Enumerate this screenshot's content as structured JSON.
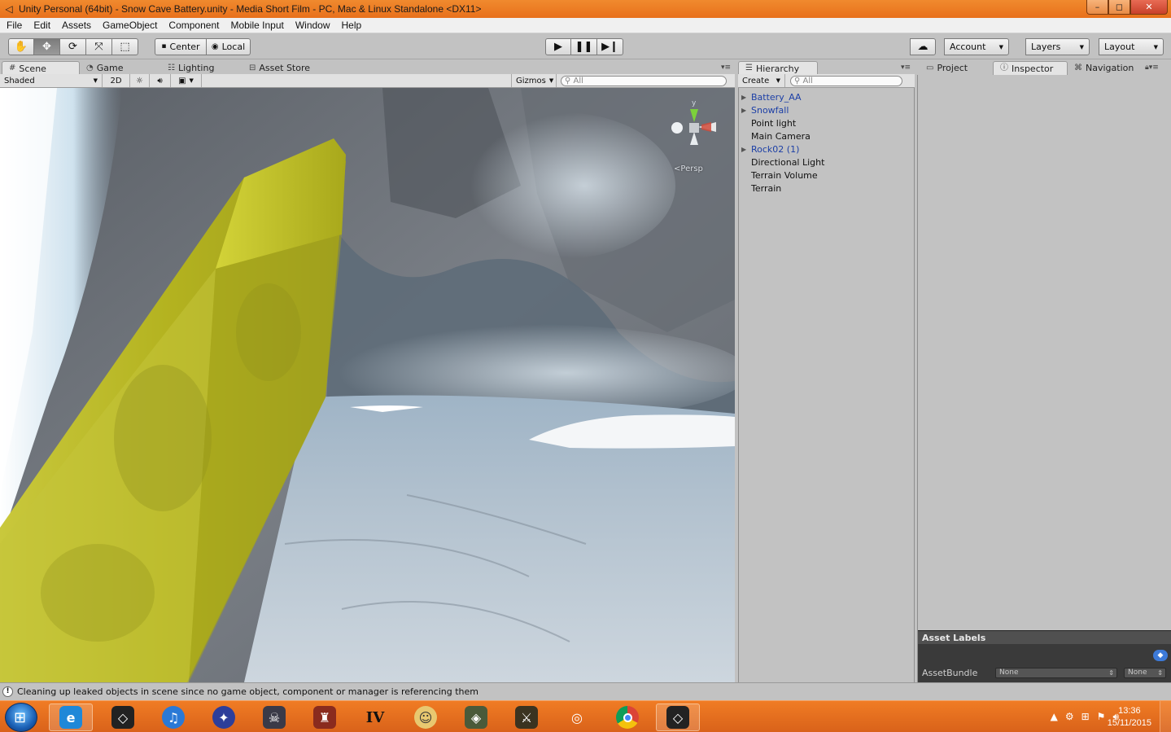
{
  "window": {
    "title": "Unity Personal (64bit) - Snow Cave Battery.unity - Media Short Film - PC, Mac & Linux Standalone <DX11>",
    "controls": {
      "minimize": "–",
      "maximize": "◻",
      "close": "✕"
    }
  },
  "menu": [
    "File",
    "Edit",
    "Assets",
    "GameObject",
    "Component",
    "Mobile Input",
    "Window",
    "Help"
  ],
  "toolbar": {
    "transform_tools": [
      "hand-icon",
      "move-icon",
      "rotate-icon",
      "scale-icon",
      "rect-icon"
    ],
    "pivot_label": "Center",
    "space_label": "Local",
    "account_label": "Account",
    "layers_label": "Layers",
    "layout_label": "Layout"
  },
  "scene_tabs": [
    {
      "label": "Scene",
      "icon": "grid-icon",
      "active": true
    },
    {
      "label": "Game",
      "icon": "pacman-icon",
      "active": false
    },
    {
      "label": "Lighting",
      "icon": "lighting-icon",
      "active": false
    },
    {
      "label": "Asset Store",
      "icon": "store-icon",
      "active": false
    }
  ],
  "scene_bar": {
    "shading": "Shaded",
    "mode_2d": "2D",
    "gizmos": "Gizmos",
    "search_placeholder": "All"
  },
  "scene_view": {
    "persp_label": "Persp",
    "gizmo_axis": "y"
  },
  "hierarchy": {
    "tab_label": "Hierarchy",
    "create_label": "Create",
    "search_placeholder": "All",
    "items": [
      {
        "label": "Battery_AA",
        "prefab": true,
        "expandable": true
      },
      {
        "label": "Snowfall",
        "prefab": true,
        "expandable": true
      },
      {
        "label": "Point light",
        "prefab": false,
        "expandable": false
      },
      {
        "label": "Main Camera",
        "prefab": false,
        "expandable": false
      },
      {
        "label": "Rock02 (1)",
        "prefab": true,
        "expandable": true
      },
      {
        "label": "Directional Light",
        "prefab": false,
        "expandable": false
      },
      {
        "label": "Terrain Volume",
        "prefab": false,
        "expandable": false
      },
      {
        "label": "Terrain",
        "prefab": false,
        "expandable": false
      }
    ]
  },
  "inspector_tabs": [
    {
      "label": "Project",
      "icon": "folder-icon",
      "active": false
    },
    {
      "label": "Inspector",
      "icon": "info-icon",
      "active": true
    },
    {
      "label": "Navigation",
      "icon": "navigation-icon",
      "active": false
    }
  ],
  "asset_labels": {
    "header": "Asset Labels",
    "assetbundle_label": "AssetBundle",
    "bundle_value": "None",
    "variant_value": "None"
  },
  "status": {
    "message": "Cleaning up leaked objects in scene since no game object, component or manager is referencing them"
  },
  "taskbar": {
    "apps": [
      "internet-explorer-icon",
      "unity-icon",
      "itunes-icon",
      "game-icon-1",
      "skull-icon",
      "game-icon-2",
      "gta-iv-icon",
      "fallout-vault-boy-icon",
      "halo-icon",
      "game-icon-3",
      "blender-icon",
      "chrome-icon",
      "unity-editor-icon"
    ],
    "time": "13:36",
    "date": "15/11/2015"
  }
}
